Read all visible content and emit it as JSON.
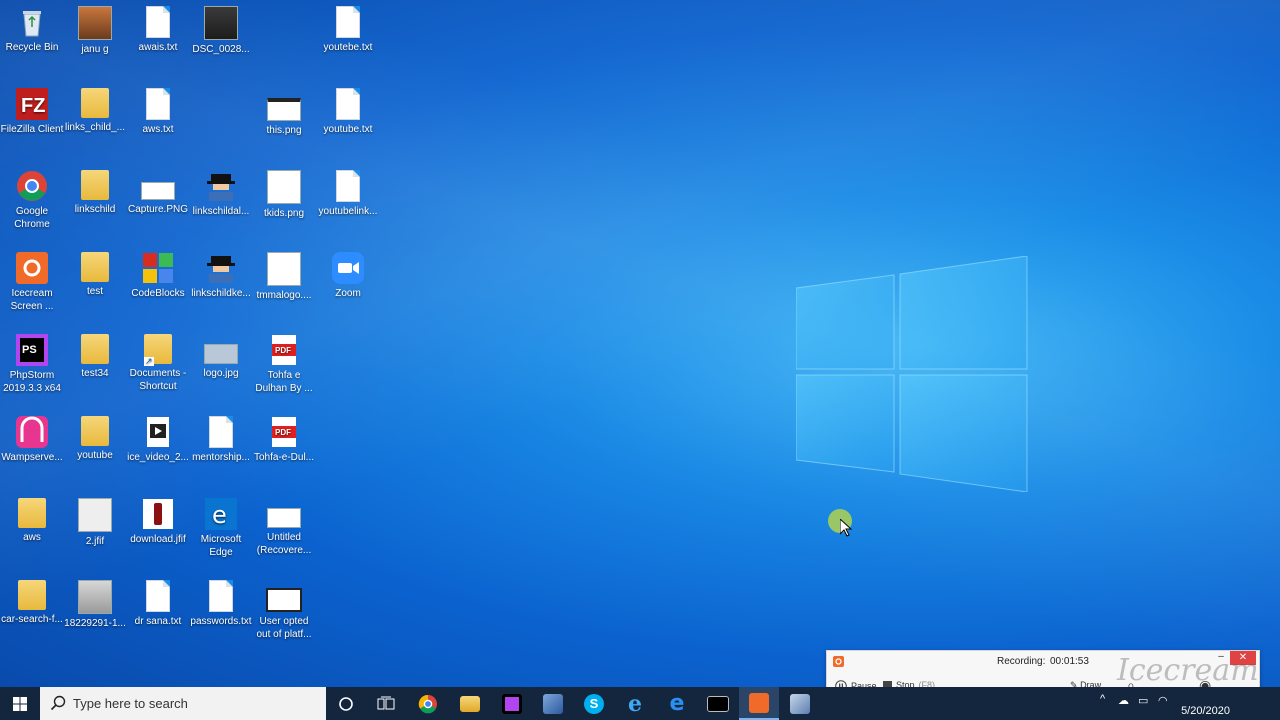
{
  "desktop": {
    "icons": [
      {
        "label": "Recycle Bin",
        "icon": "recycle-bin-icon"
      },
      {
        "label": "janu g",
        "icon": "image-icon"
      },
      {
        "label": "awais.txt",
        "icon": "text-file-icon"
      },
      {
        "label": "DSC_0028...",
        "icon": "photo-icon"
      },
      {
        "label": "youtebe.txt",
        "icon": "text-file-icon"
      },
      {
        "label": "FileZilla Client",
        "icon": "filezilla-icon"
      },
      {
        "label": "links_child_...",
        "icon": "chrome-file-icon"
      },
      {
        "label": "aws.txt",
        "icon": "text-file-icon"
      },
      {
        "label": "this.png",
        "icon": "image-icon"
      },
      {
        "label": "youtube.txt",
        "icon": "text-file-icon"
      },
      {
        "label": "Google Chrome",
        "icon": "chrome-icon"
      },
      {
        "label": "linkschild",
        "icon": "folder-icon"
      },
      {
        "label": "Capture.PNG",
        "icon": "image-icon"
      },
      {
        "label": "linkschildal...",
        "icon": "spy-icon"
      },
      {
        "label": "tkids.png",
        "icon": "image-icon"
      },
      {
        "label": "youtubelink...",
        "icon": "text-file-icon"
      },
      {
        "label": "Icecream Screen ...",
        "icon": "icecream-icon"
      },
      {
        "label": "test",
        "icon": "folder-icon"
      },
      {
        "label": "CodeBlocks",
        "icon": "codeblocks-icon"
      },
      {
        "label": "linkschildke...",
        "icon": "spy-icon"
      },
      {
        "label": "tmmalogo....",
        "icon": "image-icon"
      },
      {
        "label": "Zoom",
        "icon": "zoom-icon"
      },
      {
        "label": "PhpStorm 2019.3.3 x64",
        "icon": "phpstorm-icon"
      },
      {
        "label": "test34",
        "icon": "folder-icon"
      },
      {
        "label": "Documents - Shortcut",
        "icon": "folder-icon"
      },
      {
        "label": "logo.jpg",
        "icon": "image-icon"
      },
      {
        "label": "Tohfa e Dulhan By ...",
        "icon": "pdf-icon"
      },
      {
        "label": "Wampserve...",
        "icon": "wamp-icon"
      },
      {
        "label": "youtube",
        "icon": "folder-icon"
      },
      {
        "label": "ice_video_2...",
        "icon": "video-icon"
      },
      {
        "label": "mentorship...",
        "icon": "text-file-icon"
      },
      {
        "label": "Tohfa-e-Dul...",
        "icon": "pdf-icon"
      },
      {
        "label": "aws",
        "icon": "folder-icon"
      },
      {
        "label": "2.jfif",
        "icon": "image-icon"
      },
      {
        "label": "download.jfif",
        "icon": "image-icon"
      },
      {
        "label": "Microsoft Edge",
        "icon": "edge-icon"
      },
      {
        "label": "Untitled (Recovere...",
        "icon": "document-icon"
      },
      {
        "label": "car-search-f...",
        "icon": "chrome-file-icon"
      },
      {
        "label": "18229291-1...",
        "icon": "photo-icon"
      },
      {
        "label": "dr sana.txt",
        "icon": "text-file-icon"
      },
      {
        "label": "passwords.txt",
        "icon": "text-file-icon"
      },
      {
        "label": "User opted out of platf...",
        "icon": "image-icon"
      }
    ]
  },
  "taskbar": {
    "search_placeholder": "Type here to search",
    "apps": [
      "cortana-icon",
      "task-view-icon",
      "chrome-icon",
      "file-explorer-icon",
      "phpstorm-icon",
      "network-tool-icon",
      "skype-icon",
      "ie-icon",
      "edge-icon",
      "terminal-icon",
      "icecream-recorder-icon",
      "control-panel-icon"
    ],
    "clock_date": "5/20/2020"
  },
  "recorder": {
    "status_label": "Recording:",
    "elapsed": "00:01:53",
    "pause_label": "Pause",
    "stop_label": "Stop",
    "stop_hotkey": "(F8)",
    "draw_label": "Draw",
    "watermark": "Icecream"
  },
  "colors": {
    "accent": "#1a8be6",
    "taskbar": "#13263e",
    "recorder_close": "#e04343"
  }
}
